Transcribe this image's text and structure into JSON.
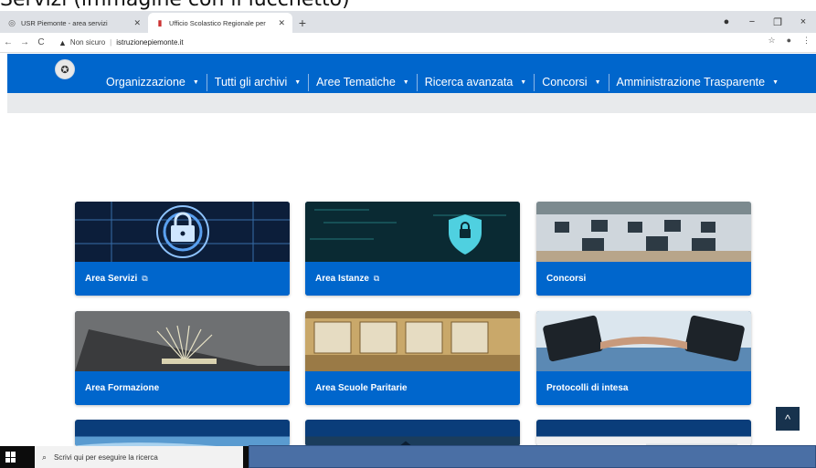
{
  "caption": "Servizi (immagine con il lucchetto)",
  "browser": {
    "tabs": [
      {
        "title": "USR Piemonte - area servizi",
        "icon": "globe-icon"
      },
      {
        "title": "Ufficio Scolastico Regionale per",
        "icon": "site-icon"
      }
    ],
    "new_tab": "+",
    "window_controls": [
      "●",
      "−",
      "❐",
      "×"
    ],
    "address": {
      "security": "Non sicuro",
      "url": "istruzionepiemonte.it"
    },
    "right_icons": [
      "star-icon",
      "profile-icon",
      "menu-icon"
    ]
  },
  "site": {
    "menu": [
      {
        "label": "Organizzazione"
      },
      {
        "label": "Tutti gli archivi"
      },
      {
        "label": "Aree Tematiche"
      },
      {
        "label": "Ricerca avanzata"
      },
      {
        "label": "Concorsi"
      },
      {
        "label": "Amministrazione Trasparente"
      }
    ],
    "tiles": [
      {
        "label": "Area Servizi",
        "external": true
      },
      {
        "label": "Area Istanze",
        "external": true
      },
      {
        "label": "Concorsi",
        "external": false
      },
      {
        "label": "Area Formazione",
        "external": false
      },
      {
        "label": "Area Scuole Paritarie",
        "external": false
      },
      {
        "label": "Protocolli di intesa",
        "external": false
      }
    ],
    "back_to_top": "^"
  },
  "taskbar": {
    "search_placeholder": "Scrivi qui per eseguire la ricerca"
  },
  "colors": {
    "brand": "#0066cc",
    "dark": "#17324d"
  }
}
